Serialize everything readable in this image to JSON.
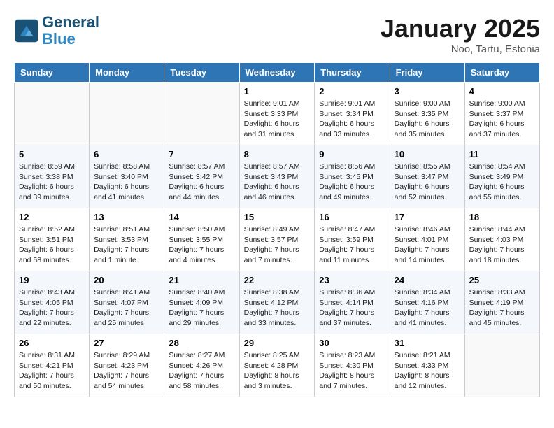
{
  "header": {
    "logo_line1": "General",
    "logo_line2": "Blue",
    "month": "January 2025",
    "location": "Noo, Tartu, Estonia"
  },
  "weekdays": [
    "Sunday",
    "Monday",
    "Tuesday",
    "Wednesday",
    "Thursday",
    "Friday",
    "Saturday"
  ],
  "weeks": [
    [
      {
        "day": "",
        "info": ""
      },
      {
        "day": "",
        "info": ""
      },
      {
        "day": "",
        "info": ""
      },
      {
        "day": "1",
        "info": "Sunrise: 9:01 AM\nSunset: 3:33 PM\nDaylight: 6 hours\nand 31 minutes."
      },
      {
        "day": "2",
        "info": "Sunrise: 9:01 AM\nSunset: 3:34 PM\nDaylight: 6 hours\nand 33 minutes."
      },
      {
        "day": "3",
        "info": "Sunrise: 9:00 AM\nSunset: 3:35 PM\nDaylight: 6 hours\nand 35 minutes."
      },
      {
        "day": "4",
        "info": "Sunrise: 9:00 AM\nSunset: 3:37 PM\nDaylight: 6 hours\nand 37 minutes."
      }
    ],
    [
      {
        "day": "5",
        "info": "Sunrise: 8:59 AM\nSunset: 3:38 PM\nDaylight: 6 hours\nand 39 minutes."
      },
      {
        "day": "6",
        "info": "Sunrise: 8:58 AM\nSunset: 3:40 PM\nDaylight: 6 hours\nand 41 minutes."
      },
      {
        "day": "7",
        "info": "Sunrise: 8:57 AM\nSunset: 3:42 PM\nDaylight: 6 hours\nand 44 minutes."
      },
      {
        "day": "8",
        "info": "Sunrise: 8:57 AM\nSunset: 3:43 PM\nDaylight: 6 hours\nand 46 minutes."
      },
      {
        "day": "9",
        "info": "Sunrise: 8:56 AM\nSunset: 3:45 PM\nDaylight: 6 hours\nand 49 minutes."
      },
      {
        "day": "10",
        "info": "Sunrise: 8:55 AM\nSunset: 3:47 PM\nDaylight: 6 hours\nand 52 minutes."
      },
      {
        "day": "11",
        "info": "Sunrise: 8:54 AM\nSunset: 3:49 PM\nDaylight: 6 hours\nand 55 minutes."
      }
    ],
    [
      {
        "day": "12",
        "info": "Sunrise: 8:52 AM\nSunset: 3:51 PM\nDaylight: 6 hours\nand 58 minutes."
      },
      {
        "day": "13",
        "info": "Sunrise: 8:51 AM\nSunset: 3:53 PM\nDaylight: 7 hours\nand 1 minute."
      },
      {
        "day": "14",
        "info": "Sunrise: 8:50 AM\nSunset: 3:55 PM\nDaylight: 7 hours\nand 4 minutes."
      },
      {
        "day": "15",
        "info": "Sunrise: 8:49 AM\nSunset: 3:57 PM\nDaylight: 7 hours\nand 7 minutes."
      },
      {
        "day": "16",
        "info": "Sunrise: 8:47 AM\nSunset: 3:59 PM\nDaylight: 7 hours\nand 11 minutes."
      },
      {
        "day": "17",
        "info": "Sunrise: 8:46 AM\nSunset: 4:01 PM\nDaylight: 7 hours\nand 14 minutes."
      },
      {
        "day": "18",
        "info": "Sunrise: 8:44 AM\nSunset: 4:03 PM\nDaylight: 7 hours\nand 18 minutes."
      }
    ],
    [
      {
        "day": "19",
        "info": "Sunrise: 8:43 AM\nSunset: 4:05 PM\nDaylight: 7 hours\nand 22 minutes."
      },
      {
        "day": "20",
        "info": "Sunrise: 8:41 AM\nSunset: 4:07 PM\nDaylight: 7 hours\nand 25 minutes."
      },
      {
        "day": "21",
        "info": "Sunrise: 8:40 AM\nSunset: 4:09 PM\nDaylight: 7 hours\nand 29 minutes."
      },
      {
        "day": "22",
        "info": "Sunrise: 8:38 AM\nSunset: 4:12 PM\nDaylight: 7 hours\nand 33 minutes."
      },
      {
        "day": "23",
        "info": "Sunrise: 8:36 AM\nSunset: 4:14 PM\nDaylight: 7 hours\nand 37 minutes."
      },
      {
        "day": "24",
        "info": "Sunrise: 8:34 AM\nSunset: 4:16 PM\nDaylight: 7 hours\nand 41 minutes."
      },
      {
        "day": "25",
        "info": "Sunrise: 8:33 AM\nSunset: 4:19 PM\nDaylight: 7 hours\nand 45 minutes."
      }
    ],
    [
      {
        "day": "26",
        "info": "Sunrise: 8:31 AM\nSunset: 4:21 PM\nDaylight: 7 hours\nand 50 minutes."
      },
      {
        "day": "27",
        "info": "Sunrise: 8:29 AM\nSunset: 4:23 PM\nDaylight: 7 hours\nand 54 minutes."
      },
      {
        "day": "28",
        "info": "Sunrise: 8:27 AM\nSunset: 4:26 PM\nDaylight: 7 hours\nand 58 minutes."
      },
      {
        "day": "29",
        "info": "Sunrise: 8:25 AM\nSunset: 4:28 PM\nDaylight: 8 hours\nand 3 minutes."
      },
      {
        "day": "30",
        "info": "Sunrise: 8:23 AM\nSunset: 4:30 PM\nDaylight: 8 hours\nand 7 minutes."
      },
      {
        "day": "31",
        "info": "Sunrise: 8:21 AM\nSunset: 4:33 PM\nDaylight: 8 hours\nand 12 minutes."
      },
      {
        "day": "",
        "info": ""
      }
    ]
  ]
}
